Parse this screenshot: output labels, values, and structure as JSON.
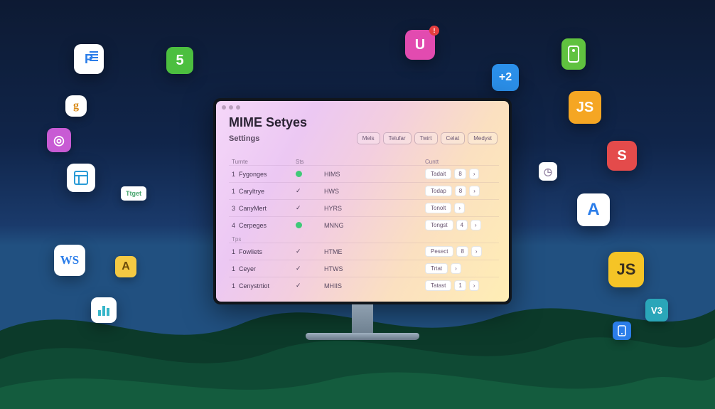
{
  "window": {
    "title": "MIME Setyes",
    "subtitle": "Settings",
    "tabs": [
      "Mels",
      "Telufar",
      "Twirt",
      "Celat",
      "Medyst"
    ]
  },
  "columns": {
    "c1": "Turnte",
    "c2": "Sts",
    "c3": "",
    "c4": "Cuntt"
  },
  "group1": [
    {
      "idx": "1",
      "name": "Fygonges",
      "status": "dot",
      "type": "HIMS",
      "action": "Tadait",
      "count": "8"
    },
    {
      "idx": "1",
      "name": "Caryltrye",
      "status": "check",
      "type": "HWS",
      "action": "Todap",
      "count": "8"
    },
    {
      "idx": "3",
      "name": "CanyMert",
      "status": "check",
      "type": "HYRS",
      "action": "Tonolt",
      "count": ""
    },
    {
      "idx": "4",
      "name": "Cerpeges",
      "status": "dot",
      "type": "MNNG",
      "action": "Tongst",
      "count": "4"
    }
  ],
  "group2_label": "Tps",
  "group2": [
    {
      "idx": "1",
      "name": "Fowliets",
      "status": "check",
      "type": "HTME",
      "action": "Pesect",
      "count": "8"
    },
    {
      "idx": "1",
      "name": "Ceyer",
      "status": "check",
      "type": "HTWS",
      "action": "Trtat",
      "count": ""
    },
    {
      "idx": "1",
      "name": "Cenystrtiot",
      "status": "check",
      "type": "МHIIS",
      "action": "Tatast",
      "count": "1"
    }
  ],
  "icons": {
    "p_blue": "P",
    "five_green": "5",
    "g": "g",
    "w_pink": "◎",
    "app_teal": "▣",
    "tag": "Ttget",
    "ws": "WS",
    "a_small": "A",
    "bars": "bars",
    "u_pink": "U",
    "plus2": "+2",
    "js_orange": "JS",
    "s_red": "S",
    "clock": "◷",
    "a_big": "A",
    "js_yellow": "JS",
    "v_teal": "V3",
    "phone": "▭"
  }
}
